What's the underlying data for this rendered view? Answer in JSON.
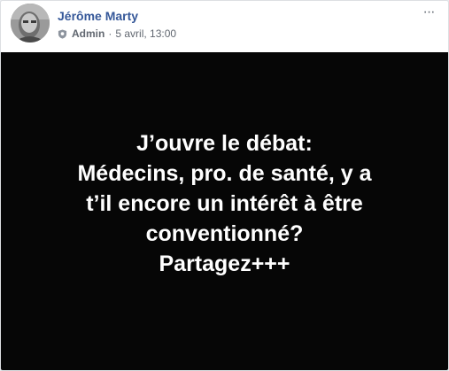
{
  "post": {
    "author": "Jérôme Marty",
    "role": "Admin",
    "separator": "·",
    "timestamp": "5 avril, 13:00",
    "more_label": "···",
    "image_text_lines": [
      "J’ouvre le débat:",
      "Médecins, pro. de santé, y a",
      "t’il encore un intérêt à être",
      "conventionné?",
      "Partagez+++"
    ]
  },
  "colors": {
    "author_link": "#365899",
    "meta_text": "#616770",
    "image_background": "#060606",
    "image_text": "#ffffff"
  }
}
